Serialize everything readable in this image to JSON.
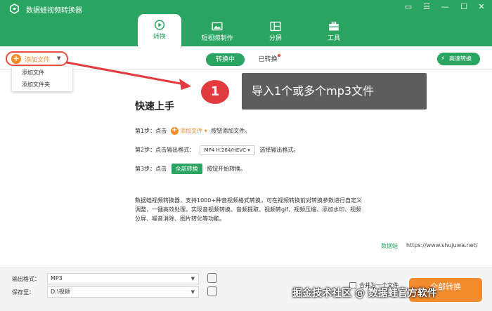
{
  "app": {
    "title": "数据蛙视频转换器"
  },
  "window_controls": [
    "▭",
    "☰",
    "—",
    "☐",
    "✕"
  ],
  "nav": {
    "tabs": [
      {
        "label": "转换",
        "icon": "convert-icon",
        "active": true
      },
      {
        "label": "短视频制作",
        "icon": "image-icon",
        "active": false
      },
      {
        "label": "分屏",
        "icon": "split-screen-icon",
        "active": false
      },
      {
        "label": "工具",
        "icon": "toolbox-icon",
        "active": false
      }
    ]
  },
  "toolbar": {
    "add_file": "添加文件",
    "segment_converting": "转换中",
    "segment_converted": "已转换",
    "speed": "高速转换"
  },
  "dropdown": {
    "items": [
      "添加文件",
      "添加文件夹"
    ]
  },
  "annotation": {
    "number": "1",
    "text": "导入1个或多个mp3文件"
  },
  "quickstart": {
    "title": "快速上手",
    "step1_prefix": "第1步：点击",
    "step1_button": "添加文件",
    "step1_suffix": "按钮添加文件。",
    "step2_prefix": "第2步：点击输出格式：",
    "step2_chip": "MP4 H.264/HEVC",
    "step2_suffix": "选择输出格式。",
    "step3_prefix": "第3步：点击",
    "step3_chip": "全部转换",
    "step3_suffix": "按钮开始转换。",
    "description": "数据蛙视频转换器，支持1000+种音视频格式转换，可在视频转换前对转换参数进行自定义调整，一键高效处理，实现音视频转换、音频提取、视频转gif、视频压缩、添加水印、视频分屏、噪音消除、图片转化等功能。",
    "brand": "数据蛙",
    "url": "https://www.shujuwa.net/"
  },
  "footer": {
    "format_label": "输出格式：",
    "format_value": "MP3",
    "save_label": "保存至：",
    "save_value": "D:\\视频",
    "merge_label": "合并为一个文件",
    "convert_all": "全部转换"
  },
  "watermark": "掘金技术社区 @ 数据蛙官方软件",
  "colors": {
    "brand_green": "#2aa561",
    "accent_orange": "#f28a2e",
    "highlight_red": "#e84c3d"
  }
}
